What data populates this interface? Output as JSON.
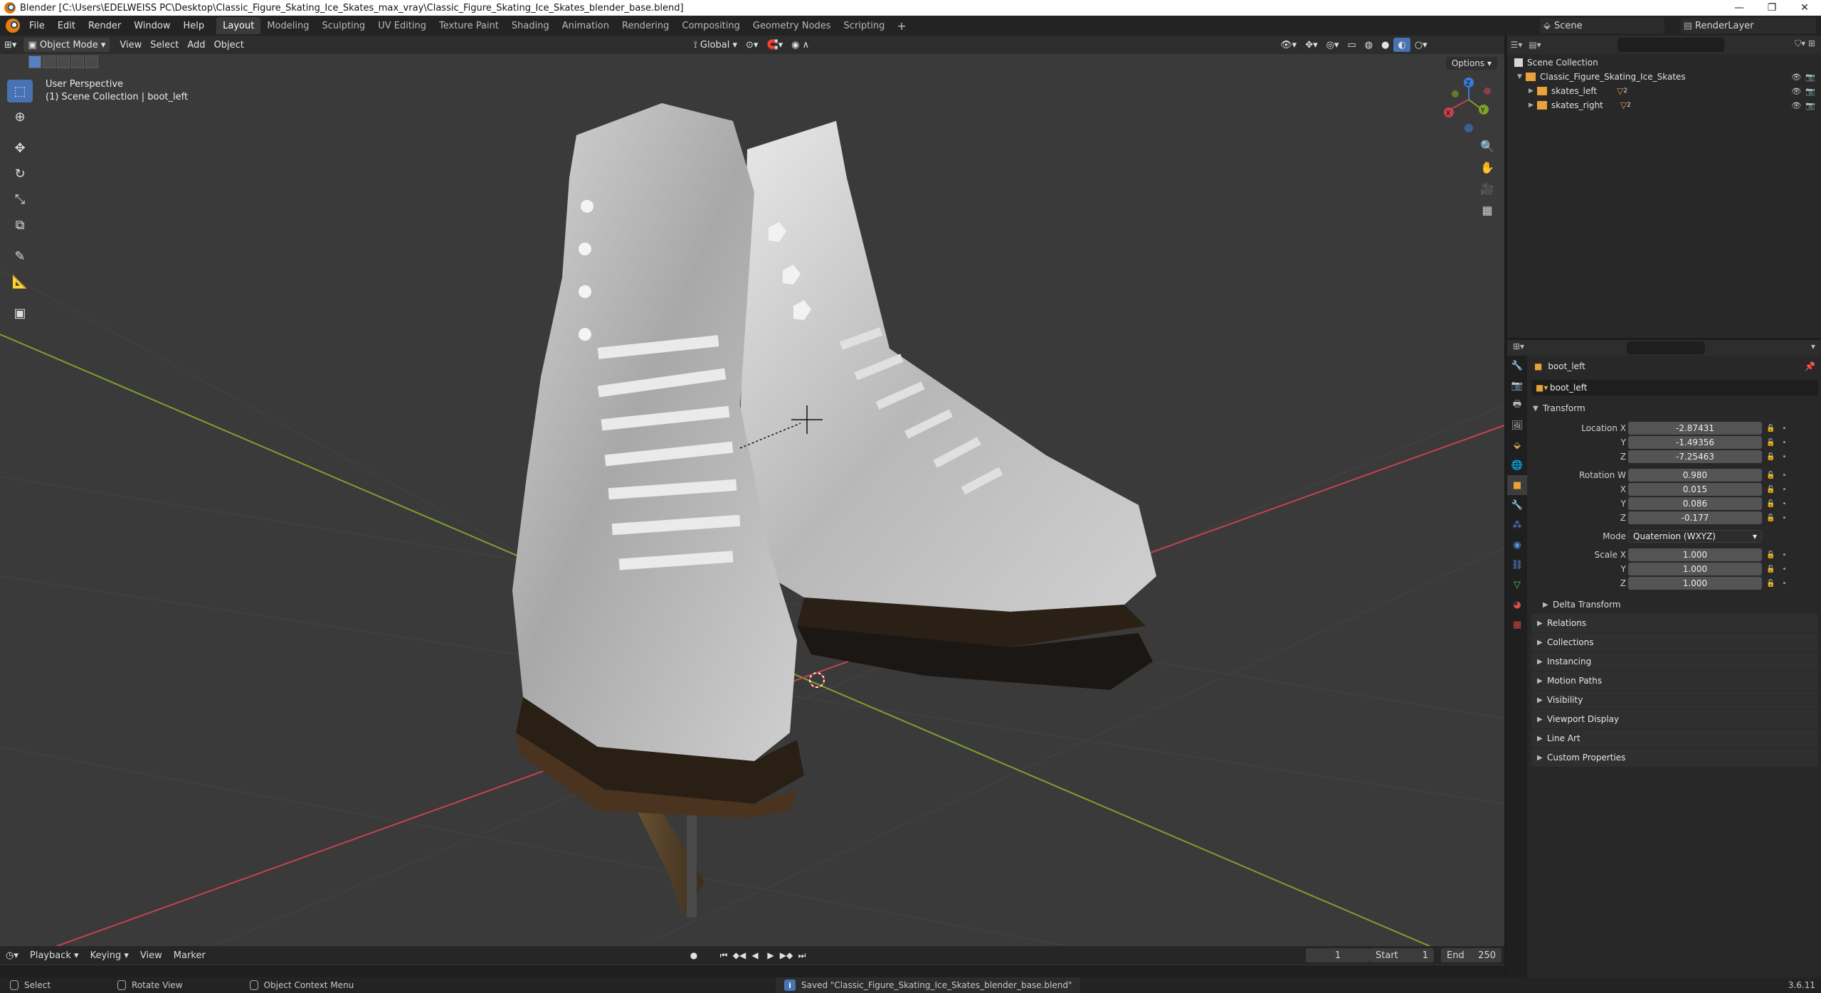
{
  "titlebar": {
    "title": "Blender [C:\\Users\\EDELWEISS PC\\Desktop\\Classic_Figure_Skating_Ice_Skates_max_vray\\Classic_Figure_Skating_Ice_Skates_blender_base.blend]",
    "minimize": "—",
    "maximize": "❐",
    "close": "✕"
  },
  "menus": [
    "File",
    "Edit",
    "Render",
    "Window",
    "Help"
  ],
  "workspaces": {
    "tabs": [
      "Layout",
      "Modeling",
      "Sculpting",
      "UV Editing",
      "Texture Paint",
      "Shading",
      "Animation",
      "Rendering",
      "Compositing",
      "Geometry Nodes",
      "Scripting"
    ],
    "active": "Layout",
    "add": "+"
  },
  "scene": {
    "name": "Scene",
    "view_layer": "RenderLayer"
  },
  "viewport": {
    "mode": "Object Mode",
    "menus": [
      "View",
      "Select",
      "Add",
      "Object"
    ],
    "orientation": "Global",
    "options": "Options",
    "perspective": "User Perspective",
    "context": "(1) Scene Collection | boot_left"
  },
  "colors": {
    "accent": "#4772b3",
    "x_axis": "#c4434f",
    "y_axis": "#7ea12d",
    "z_axis": "#3c7ad8",
    "viewport_bg": "#3a3a3a"
  },
  "toolbar_icons": [
    "select-box-icon",
    "cursor-icon",
    "move-icon",
    "rotate-icon",
    "scale-icon",
    "transform-icon",
    "annotate-icon",
    "measure-icon",
    "add-cube-icon"
  ],
  "gizmo": {
    "x": "X",
    "y": "Y",
    "z": "Z"
  },
  "outliner": {
    "root": "Scene Collection",
    "collection": "Classic_Figure_Skating_Ice_Skates",
    "items": [
      "skates_left",
      "skates_right"
    ],
    "badge_count": "2"
  },
  "properties": {
    "object_name": "boot_left",
    "data_name": "boot_left",
    "transform_title": "Transform",
    "location_label": "Location X",
    "location": {
      "x": "-2.87431",
      "y": "-1.49356",
      "z": "-7.25463"
    },
    "rotation_label": "Rotation W",
    "rotation": {
      "w": "0.980",
      "x": "0.015",
      "y": "0.086",
      "z": "-0.177"
    },
    "mode_label": "Mode",
    "mode_value": "Quaternion (WXYZ)",
    "scale_label": "Scale X",
    "scale": {
      "x": "1.000",
      "y": "1.000",
      "z": "1.000"
    },
    "axis_labels": {
      "x": "X",
      "y": "Y",
      "z": "Z"
    },
    "delta": "Delta Transform",
    "panels": [
      "Relations",
      "Collections",
      "Instancing",
      "Motion Paths",
      "Visibility",
      "Viewport Display",
      "Line Art",
      "Custom Properties"
    ]
  },
  "timeline": {
    "menus": [
      "Playback",
      "Keying",
      "View",
      "Marker"
    ],
    "current_frame": "1",
    "start_label": "Start",
    "start": "1",
    "end_label": "End",
    "end": "250"
  },
  "status": {
    "hints": [
      "Select",
      "Rotate View",
      "Object Context Menu"
    ],
    "message": "Saved \"Classic_Figure_Skating_Ice_Skates_blender_base.blend\"",
    "version": "3.6.11"
  }
}
